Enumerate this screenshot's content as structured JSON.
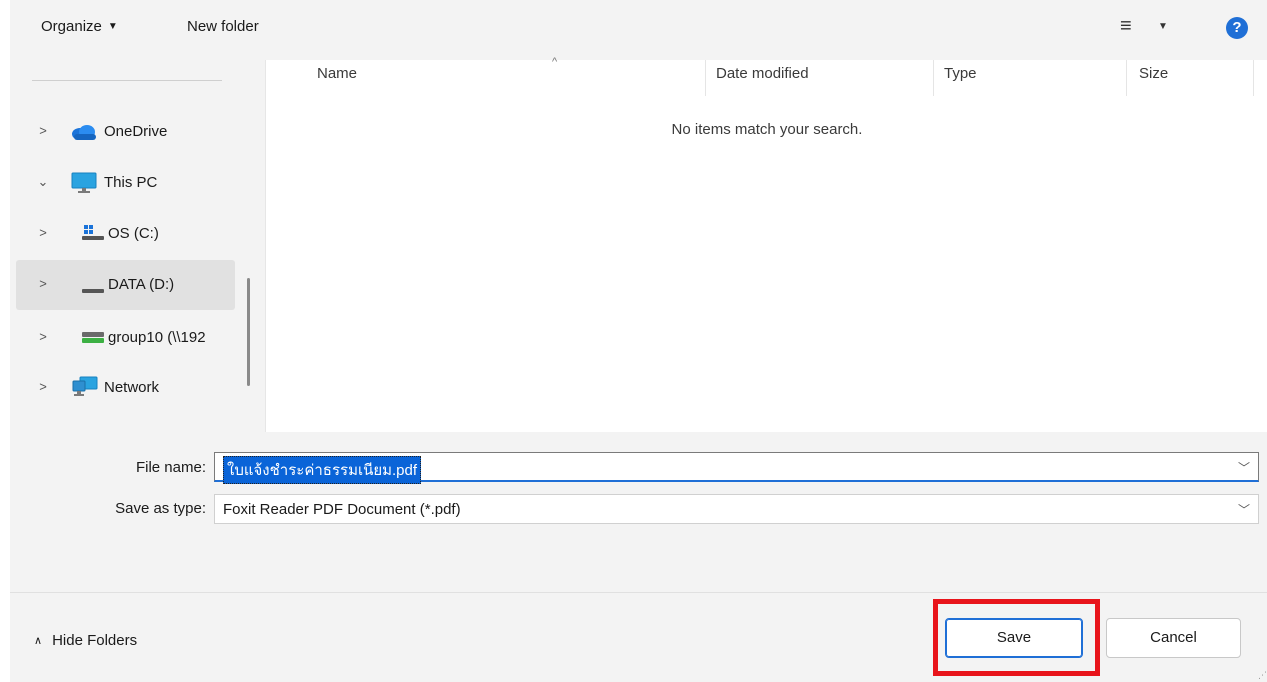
{
  "toolbar": {
    "organize_label": "Organize",
    "new_folder_label": "New folder",
    "view_icon": "details-view-icon",
    "help_icon": "help-icon",
    "help_glyph": "?"
  },
  "nav": {
    "items": [
      {
        "label": "OneDrive",
        "icon": "onedrive-cloud-icon",
        "expanded": false
      },
      {
        "label": "This PC",
        "icon": "monitor-icon",
        "expanded": true
      },
      {
        "label": "OS (C:)",
        "icon": "windows-drive-icon",
        "expanded": false
      },
      {
        "label": "DATA (D:)",
        "icon": "drive-icon",
        "expanded": false,
        "selected": true
      },
      {
        "label": "group10 (\\\\192",
        "icon": "network-drive-icon",
        "expanded": false
      },
      {
        "label": "Network",
        "icon": "network-icon",
        "expanded": false
      }
    ]
  },
  "filelist": {
    "columns": [
      "Name",
      "Date modified",
      "Type",
      "Size"
    ],
    "empty_message": "No items match your search."
  },
  "form": {
    "file_name_label": "File name:",
    "file_name_value": "ใบแจ้งชำระค่าธรรมเนียม.pdf",
    "save_type_label": "Save as type:",
    "save_type_value": "Foxit Reader PDF Document (*.pdf)"
  },
  "footer": {
    "hide_folders_label": "Hide Folders",
    "save_label": "Save",
    "cancel_label": "Cancel"
  },
  "colors": {
    "accent": "#1f6fd6",
    "highlight": "#e8141b",
    "selection": "#0a64d8"
  }
}
